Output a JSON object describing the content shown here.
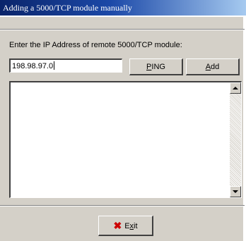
{
  "window": {
    "title": "Adding a 5000/TCP module manually"
  },
  "form": {
    "ip_label": "Enter the IP Address of remote 5000/TCP module:",
    "ip_value": "198.98.97.0",
    "ping_underline": "P",
    "ping_rest": "ING",
    "add_underline": "A",
    "add_rest": "dd"
  },
  "output_list": {
    "lines": []
  },
  "footer": {
    "exit_first": "E",
    "exit_underline": "x",
    "exit_rest": "it"
  },
  "icons": {
    "exit": "x-mark-icon",
    "scroll_up": "arrow-up-icon",
    "scroll_down": "arrow-down-icon"
  },
  "colors": {
    "title_start": "#0a246a",
    "title_end": "#a6caf0",
    "face": "#d4d0c8",
    "exit_icon": "#cc0000"
  }
}
